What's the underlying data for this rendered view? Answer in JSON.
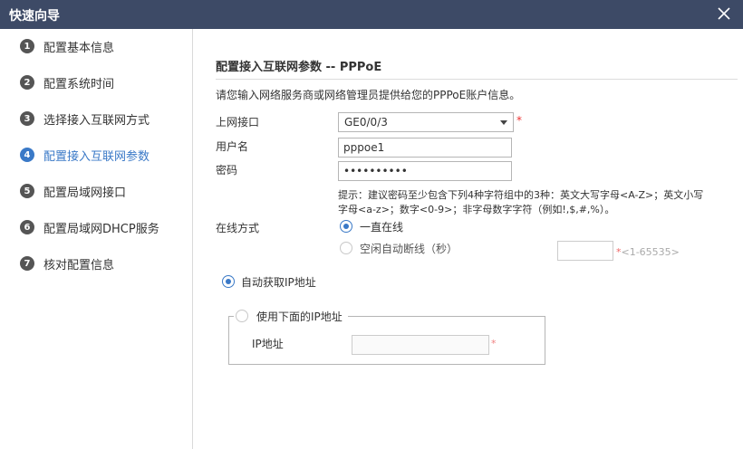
{
  "window": {
    "title": "快速向导",
    "close_icon": "close-icon"
  },
  "steps": [
    {
      "num": "1",
      "label": "配置基本信息"
    },
    {
      "num": "2",
      "label": "配置系统时间"
    },
    {
      "num": "3",
      "label": "选择接入互联网方式"
    },
    {
      "num": "4",
      "label": "配置接入互联网参数",
      "active": true
    },
    {
      "num": "5",
      "label": "配置局域网接口"
    },
    {
      "num": "6",
      "label": "配置局域网DHCP服务"
    },
    {
      "num": "7",
      "label": "核对配置信息"
    }
  ],
  "main": {
    "title": "配置接入互联网参数 -- PPPoE",
    "description": "请您输入网络服务商或网络管理员提供给您的PPPoE账户信息。",
    "interface_label": "上网接口",
    "interface_value": "GE0/0/3",
    "required_mark": "*",
    "username_label": "用户名",
    "username_value": "pppoe1",
    "password_label": "密码",
    "password_value": "••••••••••",
    "hint_text": "提示：建议密码至少包含下列4种字符组中的3种：英文大写字母<A-Z>；英文小写字母<a-z>；数字<0-9>；非字母数字字符（例如!,$,#,%）。",
    "online_mode_label": "在线方式",
    "mode_always": "一直在线",
    "mode_idle": "空闲自动断线（秒）",
    "idle_range_star": "*",
    "idle_range": "<1-65535>",
    "auto_ip_label": "自动获取IP地址",
    "manual_ip_label": "使用下面的IP地址",
    "ip_label": "IP地址",
    "ip_required_mark": "*"
  },
  "colors": {
    "titlebar": "#3d4a66",
    "accent": "#3a79c7",
    "required": "#e33333"
  }
}
